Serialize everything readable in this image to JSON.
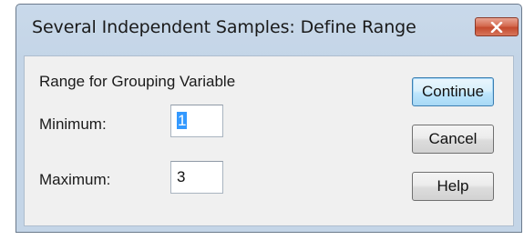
{
  "window": {
    "title": "Several Independent Samples: Define Range"
  },
  "group": {
    "heading": "Range for Grouping Variable",
    "minimum_label": "Minimum:",
    "minimum_value": "1",
    "maximum_label": "Maximum:",
    "maximum_value": "3"
  },
  "buttons": {
    "continue": "Continue",
    "cancel": "Cancel",
    "help": "Help"
  },
  "icons": {
    "close": "close-icon"
  },
  "colors": {
    "titlebar": "#c4d5e7",
    "client": "#f0f0f0",
    "close_button": "#c44a2e",
    "selection": "#3399ff"
  }
}
